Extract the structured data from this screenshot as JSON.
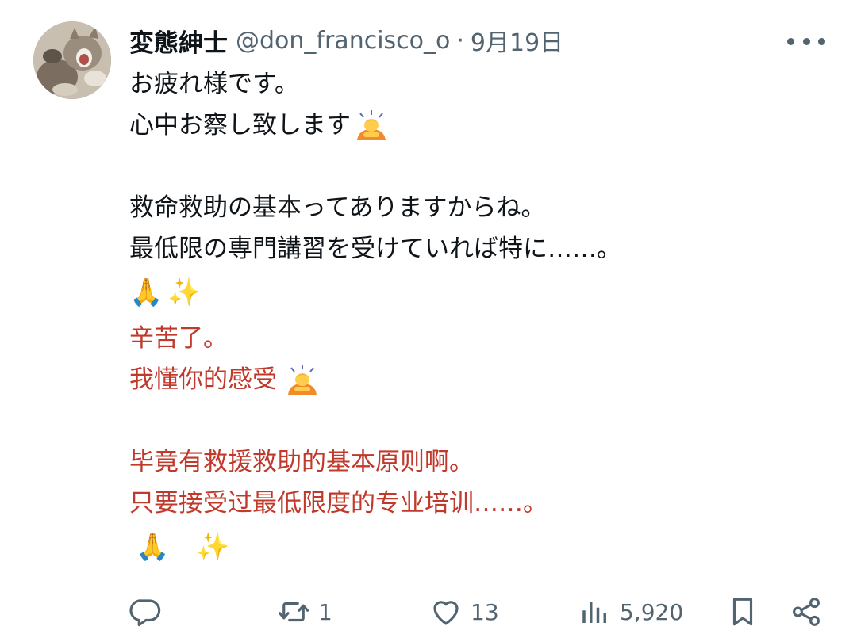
{
  "tweet": {
    "author_name": "変態紳士",
    "handle": "@don_francisco_o",
    "separator": "·",
    "date": "9月19日",
    "japanese_lines": [
      "お疲れ様です。",
      "心中お察し致します",
      "救命救助の基本ってありますからね。",
      "最低限の専門講習を受けていれば特に……。"
    ],
    "chinese_lines": [
      "辛苦了。",
      "我懂你的感受",
      "毕竟有救援救助的基本原则啊。",
      "只要接受过最低限度的专业培训……。"
    ],
    "emoji": {
      "pray": "🙏",
      "sparkles": "✨"
    },
    "icons": {
      "more": "more-dots-icon",
      "reply": "reply-bubble-icon",
      "retweet": "retweet-arrows-icon",
      "like": "heart-icon",
      "views": "views-bar-chart-icon",
      "bookmark": "bookmark-icon",
      "share": "share-icon",
      "bow": "person-bowing-icon"
    },
    "translation_color": "#c0392b"
  },
  "actions": {
    "retweet_count": "1",
    "like_count": "13",
    "views_count": "5,920"
  }
}
